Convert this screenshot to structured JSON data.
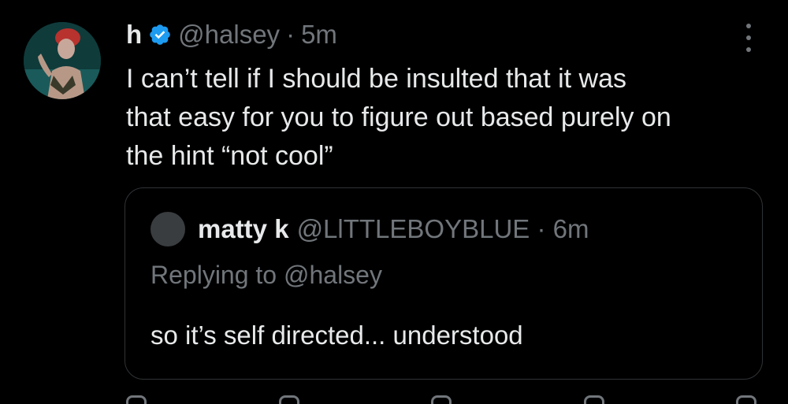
{
  "tweet": {
    "display_name": "h",
    "handle": "@halsey",
    "separator": "·",
    "time": "5m",
    "verified": true,
    "verified_color": "#1d9bf0",
    "avatar_icon": "user-avatar",
    "more_icon": "more-vertical-icon",
    "text_lines": [
      "I can’t tell if I should be insulted that it was",
      "that easy for you to figure out based purely on",
      "the hint “not cool”"
    ]
  },
  "quote": {
    "display_name": "matty k",
    "handle_time": "@LlTTLEBOYBLUE · 6m",
    "reply_prefix": "Replying to",
    "reply_mention": "@halsey",
    "text": "so it’s self directed... understood"
  },
  "actions": {
    "icons": [
      "reply-icon",
      "retweet-icon",
      "like-icon",
      "views-icon",
      "bookmark-icon"
    ]
  },
  "colors": {
    "background": "#000000",
    "text_primary": "#e7e9ea",
    "text_secondary": "#71767b",
    "border": "#2f3336"
  }
}
